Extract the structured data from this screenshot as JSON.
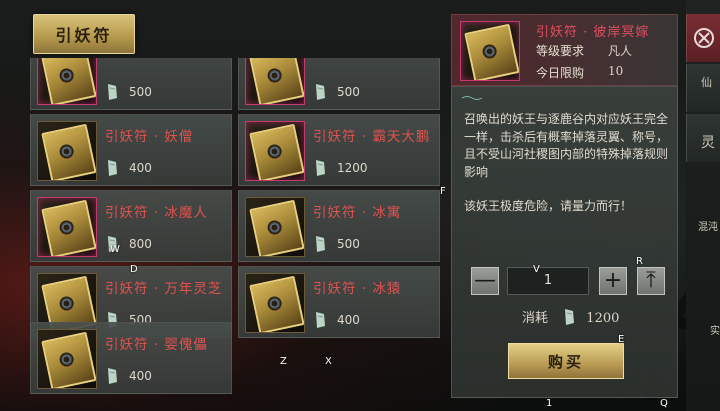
{
  "tab": {
    "label": "引妖符"
  },
  "items": [
    {
      "name": "",
      "price": "500",
      "rarity": "epic"
    },
    {
      "name": "",
      "price": "500",
      "rarity": "epic"
    },
    {
      "name": "引妖符 · 妖僧",
      "price": "400",
      "rarity": "gold"
    },
    {
      "name": "引妖符 · 霸天大鹏",
      "price": "1200",
      "rarity": "epic"
    },
    {
      "name": "引妖符 · 冰魔人",
      "price": "800",
      "rarity": "epic"
    },
    {
      "name": "引妖符 · 冰寓",
      "price": "500",
      "rarity": "gold"
    },
    {
      "name": "引妖符 · 万年灵芝",
      "price": "500",
      "rarity": "gold"
    },
    {
      "name": "引妖符 · 冰猿",
      "price": "400",
      "rarity": "gold"
    },
    {
      "name": "引妖符 · 婴傀儡",
      "price": "400",
      "rarity": "gold"
    }
  ],
  "detail": {
    "title": "引妖符 · 彼岸冥嫁",
    "level_label": "等级要求",
    "level_value": "凡人",
    "limit_label": "今日限购",
    "limit_value": "10",
    "description": "召唤出的妖王与逐鹿谷内对应妖王完全一样，击杀后有概率掉落灵翼、称号，且不受山河社稷图内部的特殊掉落规则影响",
    "warning": "该妖王极度危险，请量力而行！",
    "quantity": "1",
    "minus": "—",
    "plus": "+",
    "max": "⤒",
    "cost_label": "消耗",
    "cost_value": "1200",
    "buy_label": "购买"
  },
  "side": {
    "label_1": "仙",
    "label_2": "灵",
    "label_3": "混沌",
    "label_4": "实"
  },
  "key_hints": [
    "W",
    "D",
    "V",
    "R",
    "F",
    "E",
    "Z",
    "X",
    "1",
    "Q"
  ],
  "colors": {
    "item_name": "#e0524f",
    "title": "#e24d61",
    "gold_button": "#c9ae62"
  }
}
